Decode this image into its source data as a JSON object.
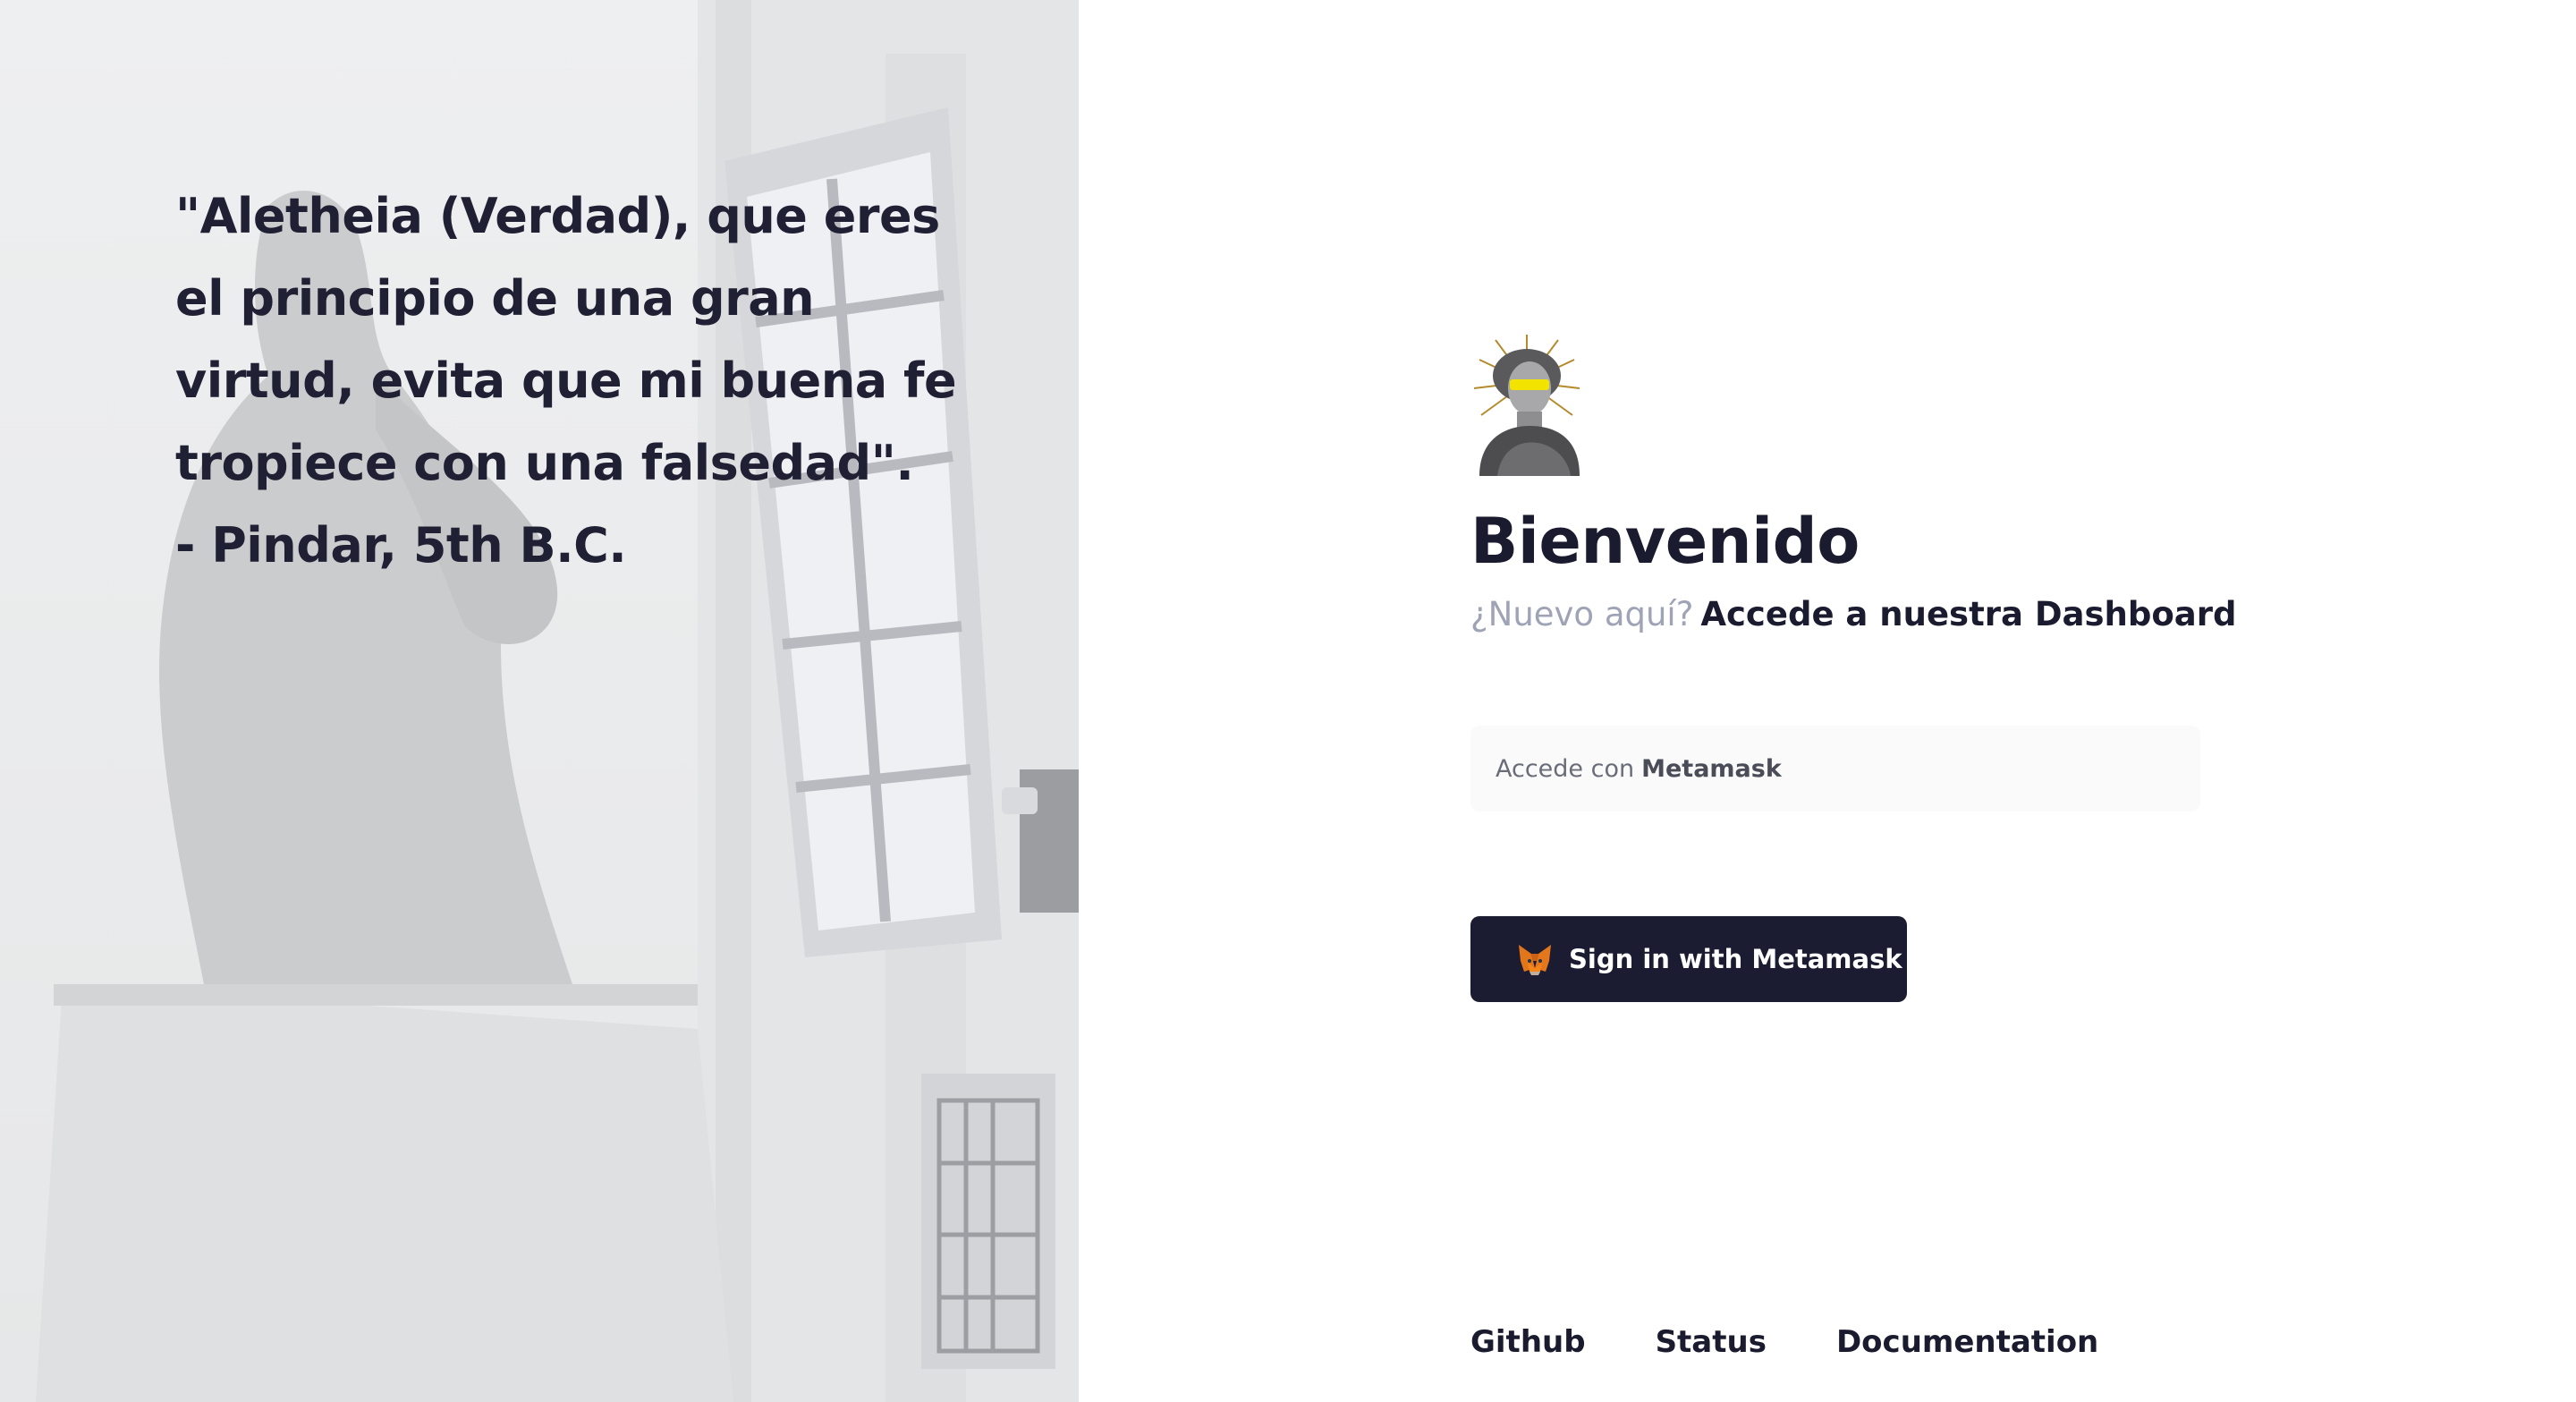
{
  "quote": {
    "lines": [
      "\"Aletheia (Verdad), que eres",
      "el principio de una gran",
      "virtud, evita que mi buena fe",
      "tropiece con una falsedad\".",
      "- Pindar, 5th B.C."
    ]
  },
  "login": {
    "title": "Bienvenido",
    "subtitle_prefix": "¿Nuevo aquí?",
    "subtitle_link": "Accede a nuestra Dashboard",
    "field_prefix": "Accede con",
    "field_strong": "Metamask",
    "signin_button_label": "Sign in with Metamask",
    "logo_icon": "statue-bust-logo",
    "button_icon": "metamask-fox-icon"
  },
  "footer": {
    "links": [
      "Github",
      "Status",
      "Documentation"
    ]
  },
  "colors": {
    "text_dark": "#1a1b2e",
    "muted": "#9fa3b6",
    "button_bg": "#1b1c31",
    "field_bg": "#fafafa"
  }
}
